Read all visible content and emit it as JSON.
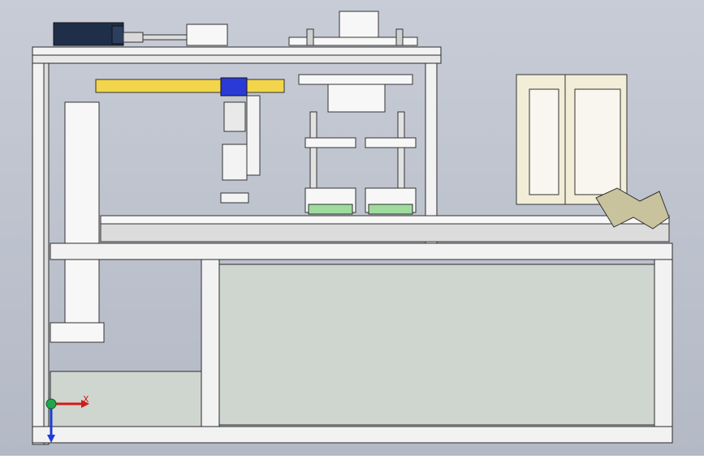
{
  "viewport": {
    "background_top": "#c7ccd6",
    "background_bottom": "#b3b9c5"
  },
  "model": {
    "frame_color": "#f2f2f2",
    "frame_shadow": "#2b2b2b",
    "panel_color": "#cfd6cf",
    "cylinder_color": "#f2d54a",
    "motor_color": "#1f2f4a",
    "blue_block_color": "#2a3ad6",
    "green_pad_color": "#9edc9e",
    "copper_color": "#c9c39d"
  },
  "triad": {
    "x_label": "X",
    "x_color": "#d21a1a",
    "y_color": "#1fa84a",
    "z_color": "#1b3dd6"
  }
}
